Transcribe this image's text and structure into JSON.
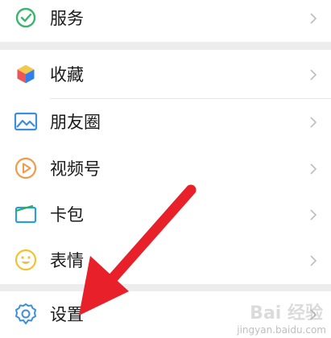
{
  "menu": {
    "items": [
      {
        "label": "服务",
        "icon": "service-icon"
      },
      {
        "label": "收藏",
        "icon": "favorites-cube-icon"
      },
      {
        "label": "朋友圈",
        "icon": "moments-picture-icon"
      },
      {
        "label": "视频号",
        "icon": "channels-play-icon"
      },
      {
        "label": "卡包",
        "icon": "card-wallet-icon"
      },
      {
        "label": "表情",
        "icon": "emoji-smile-icon"
      },
      {
        "label": "设置",
        "icon": "settings-gear-icon"
      }
    ]
  },
  "watermark": {
    "text": "Bai 经验",
    "sub": "jingyan.baidu.com"
  },
  "colors": {
    "arrow": "#e8202a",
    "section_gap": "#ededed",
    "chevron": "#bdbdbd"
  }
}
